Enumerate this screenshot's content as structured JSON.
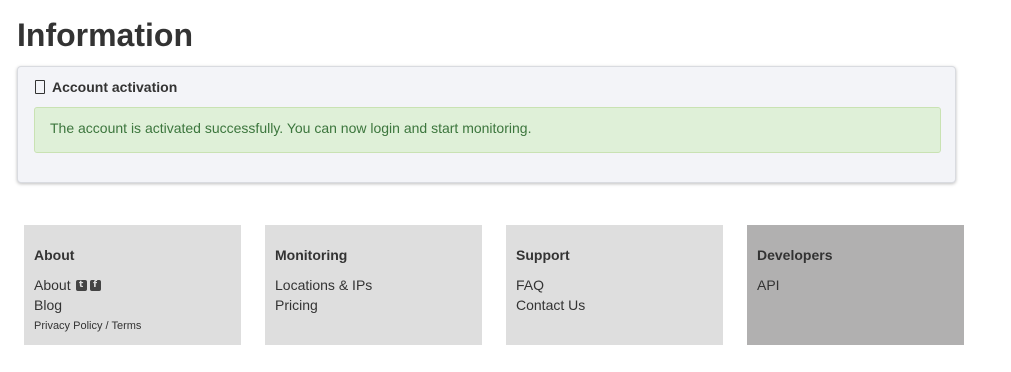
{
  "page": {
    "title": "Information"
  },
  "panel": {
    "heading": "Account activation",
    "heading_icon": "mobile-device-icon",
    "alert_text": "The account is activated successfully. You can now login and start monitoring."
  },
  "footer": {
    "about": {
      "title": "About",
      "about_link": "About",
      "twitter_icon": "twitter-icon",
      "facebook_icon": "facebook-icon",
      "blog_link": "Blog",
      "privacy_link": "Privacy Policy",
      "separator": " / ",
      "terms_link": "Terms"
    },
    "monitoring": {
      "title": "Monitoring",
      "links": [
        "Locations & IPs",
        "Pricing"
      ]
    },
    "support": {
      "title": "Support",
      "links": [
        "FAQ",
        "Contact Us"
      ]
    },
    "developers": {
      "title": "Developers",
      "links": [
        "API"
      ]
    }
  },
  "colors": {
    "alert_bg": "#dff0d8",
    "alert_text": "#3c763d",
    "footer_bg": "#dedede",
    "developers_bg": "#b1b0b0"
  }
}
